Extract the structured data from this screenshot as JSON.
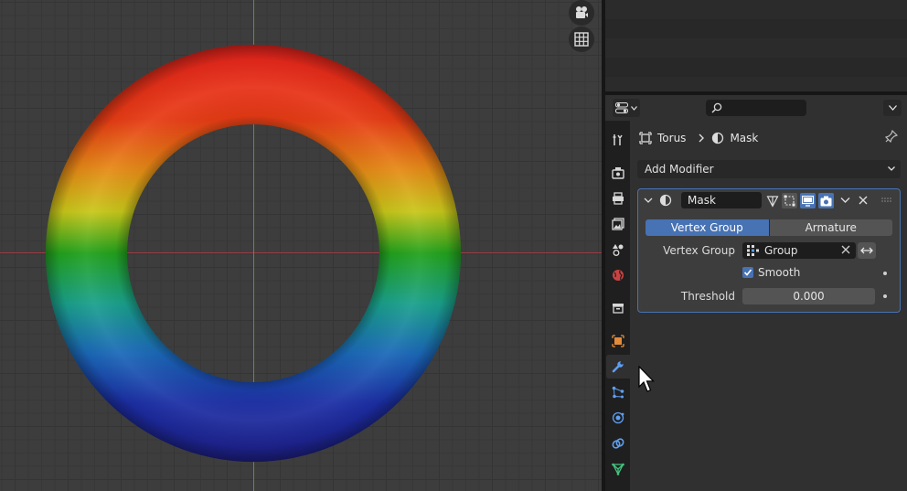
{
  "breadcrumb": {
    "object": "Torus",
    "modifier": "Mask"
  },
  "add_modifier": {
    "label": "Add Modifier"
  },
  "modifier": {
    "name": "Mask",
    "mode_options": [
      "Vertex Group",
      "Armature"
    ],
    "selected_mode": "Vertex Group",
    "vertex_group": {
      "label": "Vertex Group",
      "value": "Group"
    },
    "smooth": {
      "label": "Smooth",
      "checked": true
    },
    "threshold": {
      "label": "Threshold",
      "value": "0.000"
    }
  },
  "property_tabs": [
    "tool",
    "render",
    "output",
    "view-layer",
    "scene",
    "world",
    "collection",
    "object",
    "modifiers",
    "particles",
    "physics",
    "constraints",
    "data"
  ],
  "active_tab": "modifiers",
  "colors": {
    "accent": "#4772b3",
    "axis_x": "#9c3a43",
    "axis_y": "#6e8a2c"
  }
}
